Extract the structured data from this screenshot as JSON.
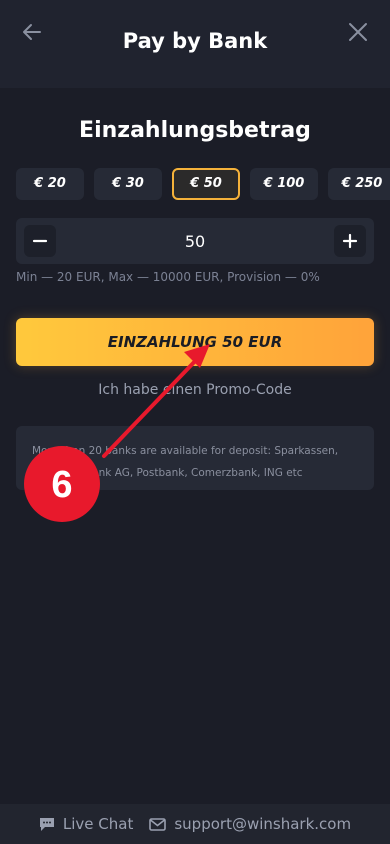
{
  "header": {
    "title": "Pay by Bank"
  },
  "deposit": {
    "section_title": "Einzahlungsbetrag",
    "chips": [
      "€ 20",
      "€ 30",
      "€ 50",
      "€ 100",
      "€ 250"
    ],
    "selected_chip": "€ 50",
    "amount_value": "50",
    "limits_text": "Min — 20 EUR, Max — 10000 EUR, Provision — 0%",
    "cta_label": "EINZAHLUNG 50 EUR",
    "promo_label": "Ich habe einen Promo-Code",
    "info_line1": "More than 20 banks are available for deposit: Sparkassen,",
    "info_line2": "Deutsche Bank AG, Postbank, Comerzbank, ING etc"
  },
  "annotation": {
    "badge_number": "6",
    "color": "#e8192c"
  },
  "footer": {
    "live_chat_label": "Live Chat",
    "support_email": "support@winshark.com"
  },
  "colors": {
    "background": "#1b1d27",
    "accent": "#ffb33b",
    "selected_border": "#f5b23a"
  }
}
